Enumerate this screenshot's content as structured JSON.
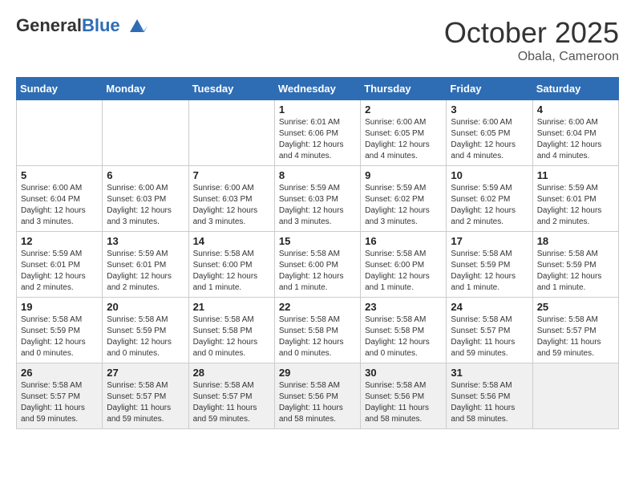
{
  "header": {
    "logo_general": "General",
    "logo_blue": "Blue",
    "month": "October 2025",
    "location": "Obala, Cameroon"
  },
  "weekdays": [
    "Sunday",
    "Monday",
    "Tuesday",
    "Wednesday",
    "Thursday",
    "Friday",
    "Saturday"
  ],
  "weeks": [
    [
      {
        "day": "",
        "info": ""
      },
      {
        "day": "",
        "info": ""
      },
      {
        "day": "",
        "info": ""
      },
      {
        "day": "1",
        "info": "Sunrise: 6:01 AM\nSunset: 6:06 PM\nDaylight: 12 hours\nand 4 minutes."
      },
      {
        "day": "2",
        "info": "Sunrise: 6:00 AM\nSunset: 6:05 PM\nDaylight: 12 hours\nand 4 minutes."
      },
      {
        "day": "3",
        "info": "Sunrise: 6:00 AM\nSunset: 6:05 PM\nDaylight: 12 hours\nand 4 minutes."
      },
      {
        "day": "4",
        "info": "Sunrise: 6:00 AM\nSunset: 6:04 PM\nDaylight: 12 hours\nand 4 minutes."
      }
    ],
    [
      {
        "day": "5",
        "info": "Sunrise: 6:00 AM\nSunset: 6:04 PM\nDaylight: 12 hours\nand 3 minutes."
      },
      {
        "day": "6",
        "info": "Sunrise: 6:00 AM\nSunset: 6:03 PM\nDaylight: 12 hours\nand 3 minutes."
      },
      {
        "day": "7",
        "info": "Sunrise: 6:00 AM\nSunset: 6:03 PM\nDaylight: 12 hours\nand 3 minutes."
      },
      {
        "day": "8",
        "info": "Sunrise: 5:59 AM\nSunset: 6:03 PM\nDaylight: 12 hours\nand 3 minutes."
      },
      {
        "day": "9",
        "info": "Sunrise: 5:59 AM\nSunset: 6:02 PM\nDaylight: 12 hours\nand 3 minutes."
      },
      {
        "day": "10",
        "info": "Sunrise: 5:59 AM\nSunset: 6:02 PM\nDaylight: 12 hours\nand 2 minutes."
      },
      {
        "day": "11",
        "info": "Sunrise: 5:59 AM\nSunset: 6:01 PM\nDaylight: 12 hours\nand 2 minutes."
      }
    ],
    [
      {
        "day": "12",
        "info": "Sunrise: 5:59 AM\nSunset: 6:01 PM\nDaylight: 12 hours\nand 2 minutes."
      },
      {
        "day": "13",
        "info": "Sunrise: 5:59 AM\nSunset: 6:01 PM\nDaylight: 12 hours\nand 2 minutes."
      },
      {
        "day": "14",
        "info": "Sunrise: 5:58 AM\nSunset: 6:00 PM\nDaylight: 12 hours\nand 1 minute."
      },
      {
        "day": "15",
        "info": "Sunrise: 5:58 AM\nSunset: 6:00 PM\nDaylight: 12 hours\nand 1 minute."
      },
      {
        "day": "16",
        "info": "Sunrise: 5:58 AM\nSunset: 6:00 PM\nDaylight: 12 hours\nand 1 minute."
      },
      {
        "day": "17",
        "info": "Sunrise: 5:58 AM\nSunset: 5:59 PM\nDaylight: 12 hours\nand 1 minute."
      },
      {
        "day": "18",
        "info": "Sunrise: 5:58 AM\nSunset: 5:59 PM\nDaylight: 12 hours\nand 1 minute."
      }
    ],
    [
      {
        "day": "19",
        "info": "Sunrise: 5:58 AM\nSunset: 5:59 PM\nDaylight: 12 hours\nand 0 minutes."
      },
      {
        "day": "20",
        "info": "Sunrise: 5:58 AM\nSunset: 5:59 PM\nDaylight: 12 hours\nand 0 minutes."
      },
      {
        "day": "21",
        "info": "Sunrise: 5:58 AM\nSunset: 5:58 PM\nDaylight: 12 hours\nand 0 minutes."
      },
      {
        "day": "22",
        "info": "Sunrise: 5:58 AM\nSunset: 5:58 PM\nDaylight: 12 hours\nand 0 minutes."
      },
      {
        "day": "23",
        "info": "Sunrise: 5:58 AM\nSunset: 5:58 PM\nDaylight: 12 hours\nand 0 minutes."
      },
      {
        "day": "24",
        "info": "Sunrise: 5:58 AM\nSunset: 5:57 PM\nDaylight: 11 hours\nand 59 minutes."
      },
      {
        "day": "25",
        "info": "Sunrise: 5:58 AM\nSunset: 5:57 PM\nDaylight: 11 hours\nand 59 minutes."
      }
    ],
    [
      {
        "day": "26",
        "info": "Sunrise: 5:58 AM\nSunset: 5:57 PM\nDaylight: 11 hours\nand 59 minutes."
      },
      {
        "day": "27",
        "info": "Sunrise: 5:58 AM\nSunset: 5:57 PM\nDaylight: 11 hours\nand 59 minutes."
      },
      {
        "day": "28",
        "info": "Sunrise: 5:58 AM\nSunset: 5:57 PM\nDaylight: 11 hours\nand 59 minutes."
      },
      {
        "day": "29",
        "info": "Sunrise: 5:58 AM\nSunset: 5:56 PM\nDaylight: 11 hours\nand 58 minutes."
      },
      {
        "day": "30",
        "info": "Sunrise: 5:58 AM\nSunset: 5:56 PM\nDaylight: 11 hours\nand 58 minutes."
      },
      {
        "day": "31",
        "info": "Sunrise: 5:58 AM\nSunset: 5:56 PM\nDaylight: 11 hours\nand 58 minutes."
      },
      {
        "day": "",
        "info": ""
      }
    ]
  ]
}
